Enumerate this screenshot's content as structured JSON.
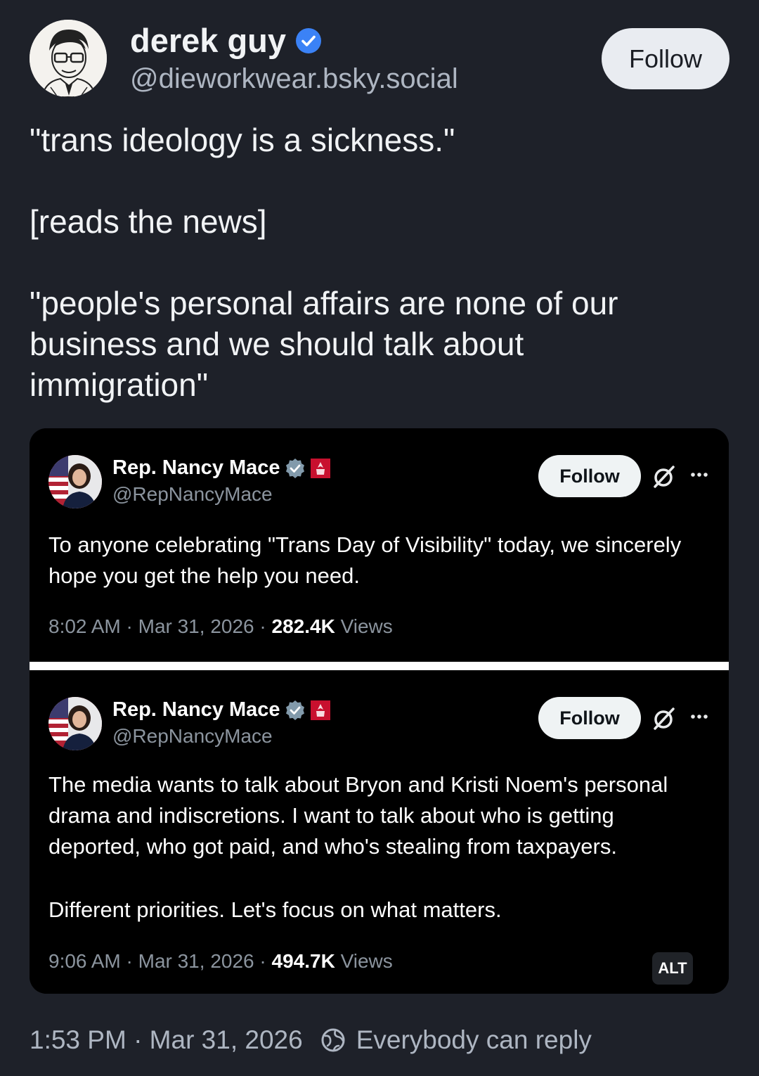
{
  "author": {
    "name": "derek guy",
    "handle": "@dieworkwear.bsky.social",
    "follow_label": "Follow"
  },
  "post": {
    "paragraphs": [
      "\"trans ideology is a sickness.\"",
      "[reads the news]",
      "\"people's personal affairs are none of our business and we should talk about immigration\""
    ],
    "timestamp": "1:53 PM · Mar 31, 2026",
    "reply_setting": "Everybody can reply"
  },
  "embed": {
    "tweets": [
      {
        "name": "Rep. Nancy Mace",
        "handle": "@RepNancyMace",
        "follow_label": "Follow",
        "paragraphs": [
          "To anyone celebrating \"Trans Day of Visibility\" today, we sincerely hope you get the help you need."
        ],
        "time": "8:02 AM · Mar 31, 2026 · ",
        "views": "282.4K",
        "views_label": " Views"
      },
      {
        "name": "Rep. Nancy Mace",
        "handle": "@RepNancyMace",
        "follow_label": "Follow",
        "paragraphs": [
          "The media wants to talk about Bryon and Kristi Noem's personal drama and indiscretions. I want to talk about who is getting deported, who got paid, and who's stealing from taxpayers.",
          "Different priorities. Let's focus on what matters."
        ],
        "time": "9:06 AM · Mar 31, 2026 · ",
        "views": "494.7K",
        "views_label": " Views"
      }
    ],
    "alt_label": "ALT"
  },
  "icons": {
    "verified": "verified-badge-icon",
    "flag": "us-flag-avatar",
    "grok": "grok-icon",
    "more": "more-options-icon",
    "globe": "globe-icon"
  },
  "colors": {
    "background": "#1e2129",
    "verified": "#3b82f6",
    "muted": "#aeb6c2",
    "embed_bg": "#000000"
  }
}
